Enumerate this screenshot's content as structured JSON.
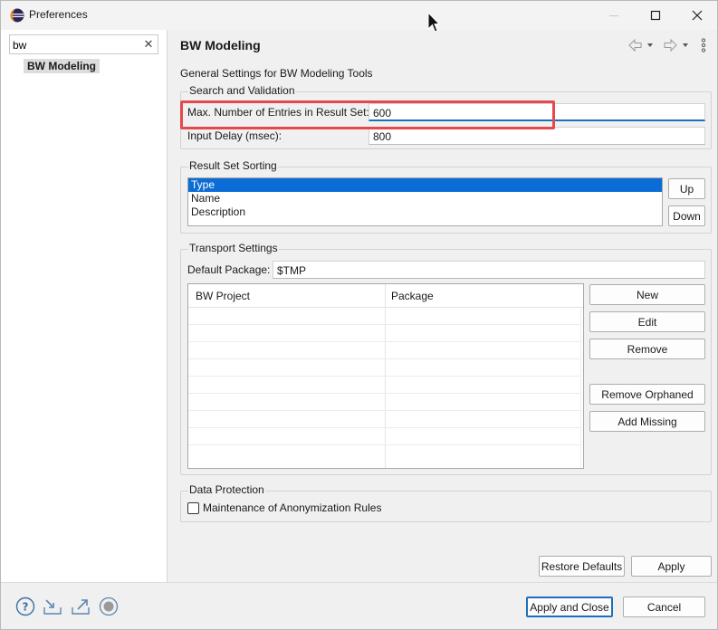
{
  "window": {
    "title": "Preferences",
    "controls": {
      "minimize": "minimize-icon",
      "maximize": "maximize-icon",
      "close": "close-icon"
    }
  },
  "sidebar": {
    "filter_value": "bw",
    "filter_clear_glyph": "✕",
    "items": [
      {
        "label": "BW Modeling",
        "selected": true
      }
    ]
  },
  "page": {
    "title": "BW Modeling",
    "description": "General Settings for BW Modeling Tools",
    "nav_icons": [
      "back-arrow-icon",
      "back-menu-icon",
      "forward-arrow-icon",
      "forward-menu-icon",
      "view-menu-icon"
    ]
  },
  "search_validation": {
    "title": "Search and Validation",
    "max_entries_label": "Max. Number of Entries in Result Set:",
    "max_entries_value": "600",
    "input_delay_label": "Input Delay (msec):",
    "input_delay_value": "800"
  },
  "sorting": {
    "title": "Result Set Sorting",
    "items": [
      "Type",
      "Name",
      "Description"
    ],
    "selected_index": 0,
    "up_label": "Up",
    "down_label": "Down"
  },
  "transport": {
    "title": "Transport Settings",
    "default_package_label": "Default Package:",
    "default_package_value": "$TMP",
    "columns": [
      "BW Project",
      "Package"
    ],
    "buttons": {
      "new": "New",
      "edit": "Edit",
      "remove": "Remove",
      "remove_orphaned": "Remove Orphaned",
      "add_missing": "Add Missing"
    }
  },
  "data_protection": {
    "title": "Data Protection",
    "checkbox_label": "Maintenance of Anonymization Rules",
    "checked": false
  },
  "page_buttons": {
    "restore_defaults": "Restore Defaults",
    "apply": "Apply"
  },
  "footer": {
    "icons": [
      "help-icon",
      "import-icon",
      "export-icon",
      "record-icon"
    ],
    "apply_and_close": "Apply and Close",
    "cancel": "Cancel"
  },
  "colors": {
    "accent": "#1d6fb8",
    "selection": "#0a6cd4",
    "highlight": "#e5484d"
  }
}
